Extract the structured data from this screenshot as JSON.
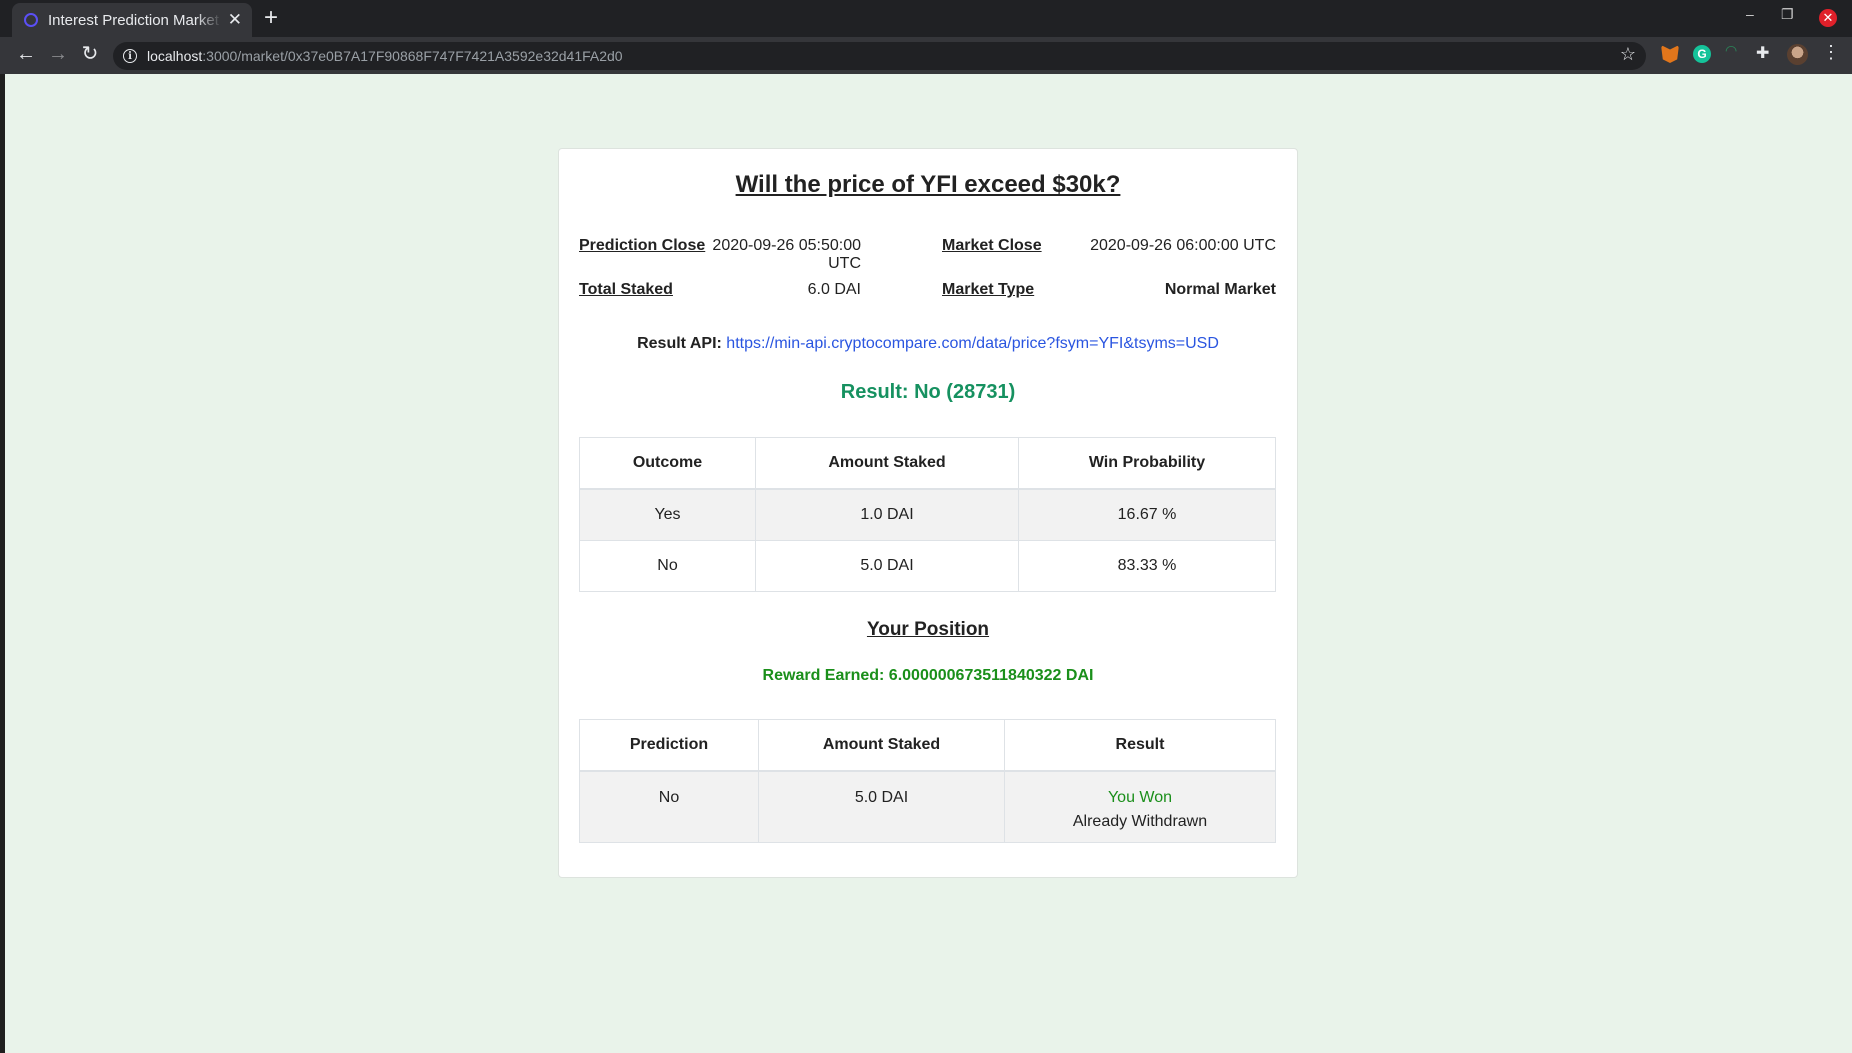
{
  "browser": {
    "tab_title": "Interest Prediction Market",
    "tab_close": "✕",
    "new_tab": "+",
    "url_host": "localhost",
    "url_rest": ":3000/market/0x37e0B7A17F90868F747F7421A3592e32d41FA2d0"
  },
  "market": {
    "question": "Will the price of YFI exceed $30k?",
    "prediction_close_label": "Prediction Close",
    "prediction_close_value": "2020-09-26 05:50:00 UTC",
    "market_close_label": "Market Close",
    "market_close_value": "2020-09-26 06:00:00 UTC",
    "total_staked_label": "Total Staked",
    "total_staked_value": "6.0 DAI",
    "market_type_label": "Market Type",
    "market_type_value": "Normal Market",
    "result_api_label": "Result API:",
    "result_api_url": "https://min-api.cryptocompare.com/data/price?fsym=YFI&tsyms=USD",
    "result_text": "Result: No (28731)"
  },
  "outcomes_table": {
    "headers": [
      "Outcome",
      "Amount Staked",
      "Win Probability"
    ],
    "rows": [
      [
        "Yes",
        "1.0 DAI",
        "16.67 %"
      ],
      [
        "No",
        "5.0 DAI",
        "83.33 %"
      ]
    ]
  },
  "position": {
    "title": "Your Position",
    "reward_text": "Reward Earned: 6.000000673511840322 DAI",
    "headers": [
      "Prediction",
      "Amount Staked",
      "Result"
    ],
    "row": {
      "prediction": "No",
      "amount": "5.0 DAI",
      "result_status": "You Won",
      "result_note": "Already Withdrawn"
    }
  },
  "colors": {
    "page_bg": "#e9f3ea",
    "result_green": "#169160",
    "reward_green": "#1a8f1a",
    "link_blue": "#2a55e0"
  }
}
